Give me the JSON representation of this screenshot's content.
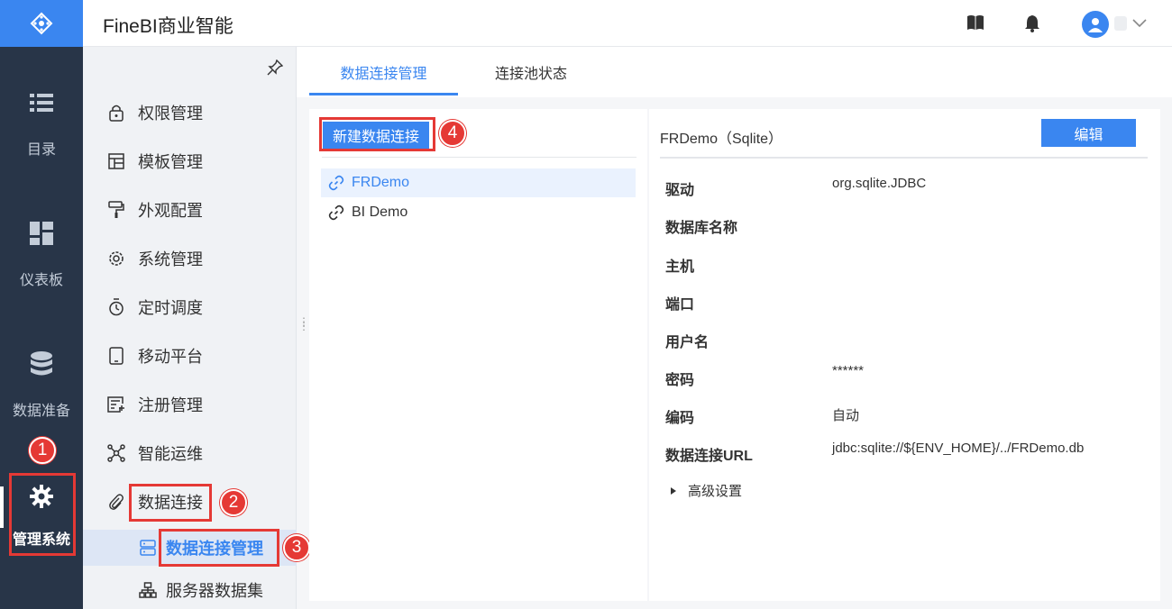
{
  "rail": {
    "items": [
      {
        "label": "目录",
        "icon": "list-icon"
      },
      {
        "label": "仪表板",
        "icon": "dashboard-icon"
      },
      {
        "label": "数据准备",
        "icon": "database-icon"
      },
      {
        "label": "管理系统",
        "icon": "gear-icon"
      }
    ]
  },
  "header": {
    "title": "FineBI商业智能"
  },
  "subnav": {
    "items": [
      {
        "label": "权限管理",
        "icon": "lock-icon"
      },
      {
        "label": "模板管理",
        "icon": "template-icon"
      },
      {
        "label": "外观配置",
        "icon": "paint-roller-icon"
      },
      {
        "label": "系统管理",
        "icon": "settings-icon"
      },
      {
        "label": "定时调度",
        "icon": "timer-icon"
      },
      {
        "label": "移动平台",
        "icon": "mobile-icon"
      },
      {
        "label": "注册管理",
        "icon": "register-icon"
      },
      {
        "label": "智能运维",
        "icon": "network-icon"
      },
      {
        "label": "数据连接",
        "icon": "paperclip-icon"
      }
    ],
    "sub_items": [
      {
        "label": "数据连接管理",
        "icon": "server-icon"
      },
      {
        "label": "服务器数据集",
        "icon": "hierarchy-icon"
      }
    ]
  },
  "tabs": [
    {
      "label": "数据连接管理"
    },
    {
      "label": "连接池状态"
    }
  ],
  "connections": {
    "new_button": "新建数据连接",
    "items": [
      {
        "label": "FRDemo"
      },
      {
        "label": "BI Demo"
      }
    ]
  },
  "detail": {
    "title": "FRDemo（Sqlite）",
    "edit_button": "编辑",
    "fields": [
      {
        "label": "驱动",
        "value": "org.sqlite.JDBC"
      },
      {
        "label": "数据库名称",
        "value": ""
      },
      {
        "label": "主机",
        "value": ""
      },
      {
        "label": "端口",
        "value": ""
      },
      {
        "label": "用户名",
        "value": ""
      },
      {
        "label": "密码",
        "value": "******"
      },
      {
        "label": "编码",
        "value": "自动"
      },
      {
        "label": "数据连接URL",
        "value": "jdbc:sqlite://${ENV_HOME}/../FRDemo.db"
      }
    ],
    "advanced": "高级设置"
  },
  "annotations": [
    "1",
    "2",
    "3",
    "4"
  ],
  "colors": {
    "accent": "#3a86f0",
    "rail": "#283548",
    "annotation": "#e53935"
  }
}
